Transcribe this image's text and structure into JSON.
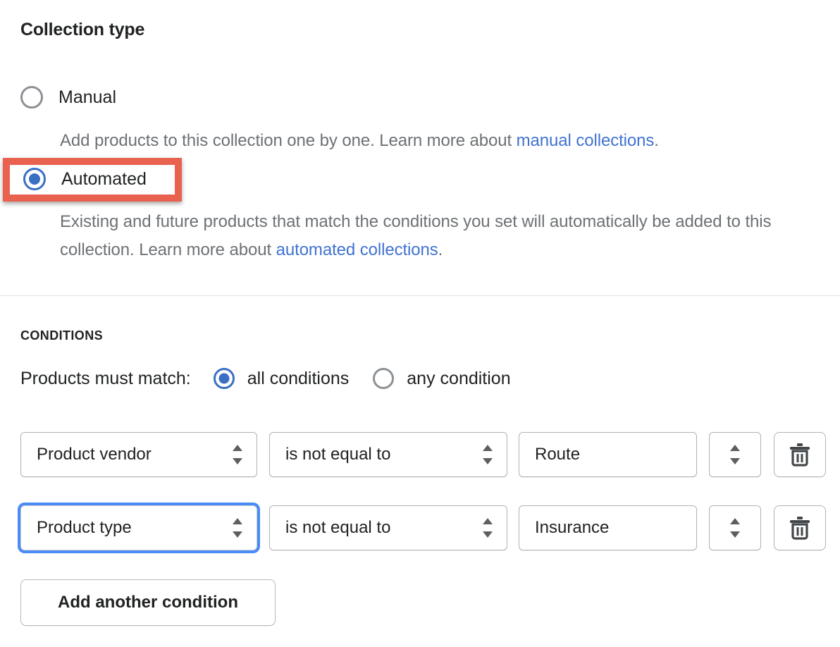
{
  "section": {
    "title": "Collection type"
  },
  "collection_type": {
    "options": [
      {
        "label": "Manual",
        "selected": false,
        "description_before_link": "Add products to this collection one by one. Learn more about ",
        "link_text": "manual collections",
        "description_after_link": "."
      },
      {
        "label": "Automated",
        "selected": true,
        "description_before_link": "Existing and future products that match the conditions you set will automatically be added to this collection. Learn more about ",
        "link_text": "automated collections",
        "description_after_link": "."
      }
    ]
  },
  "conditions": {
    "heading": "CONDITIONS",
    "match_label": "Products must match:",
    "match_options": [
      {
        "label": "all conditions",
        "selected": true
      },
      {
        "label": "any condition",
        "selected": false
      }
    ],
    "rows": [
      {
        "field": "Product vendor",
        "operator": "is not equal to",
        "value": "Route",
        "value_select_placeholder": "",
        "delete_icon": "trash-icon",
        "focused": false
      },
      {
        "field": "Product type",
        "operator": "is not equal to",
        "value": "Insurance",
        "value_select_placeholder": "",
        "delete_icon": "trash-icon",
        "focused": true
      }
    ],
    "add_button_label": "Add another condition"
  },
  "annotation": {
    "shape": "rectangle",
    "color": "#e8624f",
    "target": "Automated radio option",
    "border_width_px": 10
  },
  "colors": {
    "accent_blue": "#3a6fc4",
    "link_blue": "#4173d1",
    "text_primary": "#202223",
    "text_secondary": "#6d7175",
    "border": "#aeb4b9",
    "divider": "#e1e3e5",
    "annotation_red": "#e8624f",
    "focus_ring": "#4a8bf5"
  }
}
